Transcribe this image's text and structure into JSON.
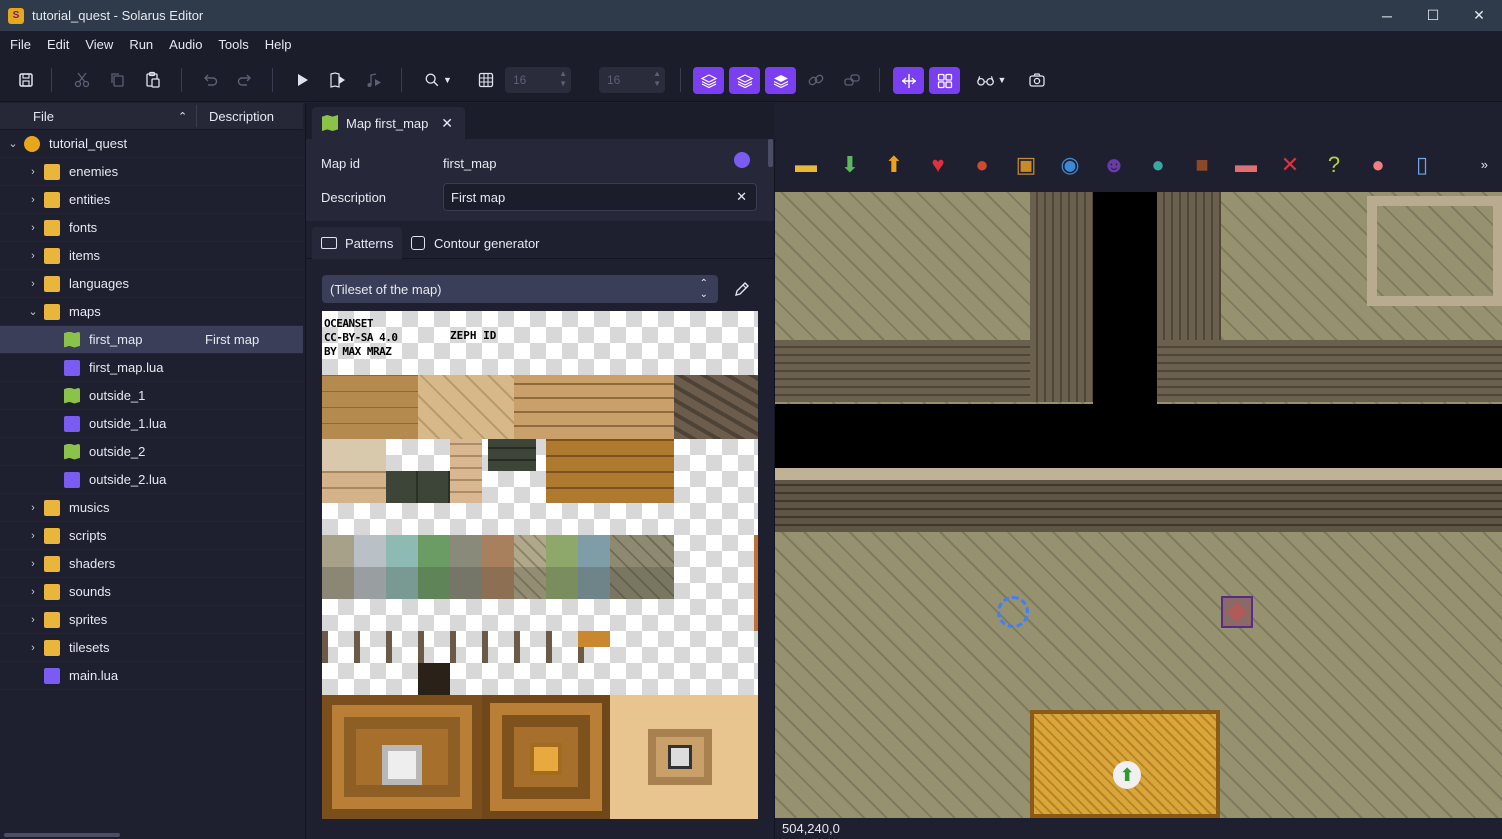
{
  "window": {
    "title": "tutorial_quest - Solarus Editor",
    "controls": {
      "minimize": "─",
      "maximize": "☐",
      "close": "✕"
    }
  },
  "menu": [
    "File",
    "Edit",
    "View",
    "Run",
    "Audio",
    "Tools",
    "Help"
  ],
  "toolbar": {
    "grid_width": "16",
    "grid_height": "16"
  },
  "file_tree": {
    "header_file": "File",
    "header_description": "Description",
    "items": [
      {
        "label": "tutorial_quest",
        "type": "root",
        "expanded": true,
        "description": ""
      },
      {
        "label": "enemies",
        "type": "folder",
        "description": ""
      },
      {
        "label": "entities",
        "type": "folder",
        "description": ""
      },
      {
        "label": "fonts",
        "type": "folder",
        "description": ""
      },
      {
        "label": "items",
        "type": "folder",
        "description": ""
      },
      {
        "label": "languages",
        "type": "folder",
        "description": ""
      },
      {
        "label": "maps",
        "type": "folder",
        "expanded": true,
        "description": ""
      },
      {
        "label": "first_map",
        "type": "map",
        "description": "First map",
        "selected": true
      },
      {
        "label": "first_map.lua",
        "type": "lua",
        "description": ""
      },
      {
        "label": "outside_1",
        "type": "map",
        "description": ""
      },
      {
        "label": "outside_1.lua",
        "type": "lua",
        "description": ""
      },
      {
        "label": "outside_2",
        "type": "map",
        "description": ""
      },
      {
        "label": "outside_2.lua",
        "type": "lua",
        "description": ""
      },
      {
        "label": "musics",
        "type": "folder",
        "description": ""
      },
      {
        "label": "scripts",
        "type": "folder",
        "description": ""
      },
      {
        "label": "shaders",
        "type": "folder",
        "description": ""
      },
      {
        "label": "sounds",
        "type": "folder",
        "description": ""
      },
      {
        "label": "sprites",
        "type": "folder",
        "description": ""
      },
      {
        "label": "tilesets",
        "type": "folder",
        "description": ""
      },
      {
        "label": "main.lua",
        "type": "lua",
        "description": ""
      }
    ]
  },
  "editor": {
    "tab_label": "Map first_map",
    "map_id_label": "Map id",
    "map_id_value": "first_map",
    "description_label": "Description",
    "description_value": "First map",
    "subtabs": [
      "Patterns",
      "Contour generator"
    ],
    "tileset_select": "(Tileset of the map)",
    "tileset_credit": [
      "OCEANSET",
      "CC-BY-SA 4.0",
      "BY MAX MRAZ",
      "ZEPH ID"
    ]
  },
  "entity_palette": [
    "destructible-icon",
    "teletransporter-icon",
    "jumper-icon",
    "heart-icon",
    "pot-icon",
    "chest-icon",
    "npc-blue-icon",
    "enemy-icon",
    "npc-icon",
    "block-icon",
    "bed-icon",
    "sensor-icon",
    "custom-entity-icon",
    "crystal-icon",
    "switch-icon"
  ],
  "status_bar": {
    "coordinates": "504,240,0"
  },
  "colors": {
    "accent": "#7b3ff2",
    "background": "#1e2030"
  }
}
